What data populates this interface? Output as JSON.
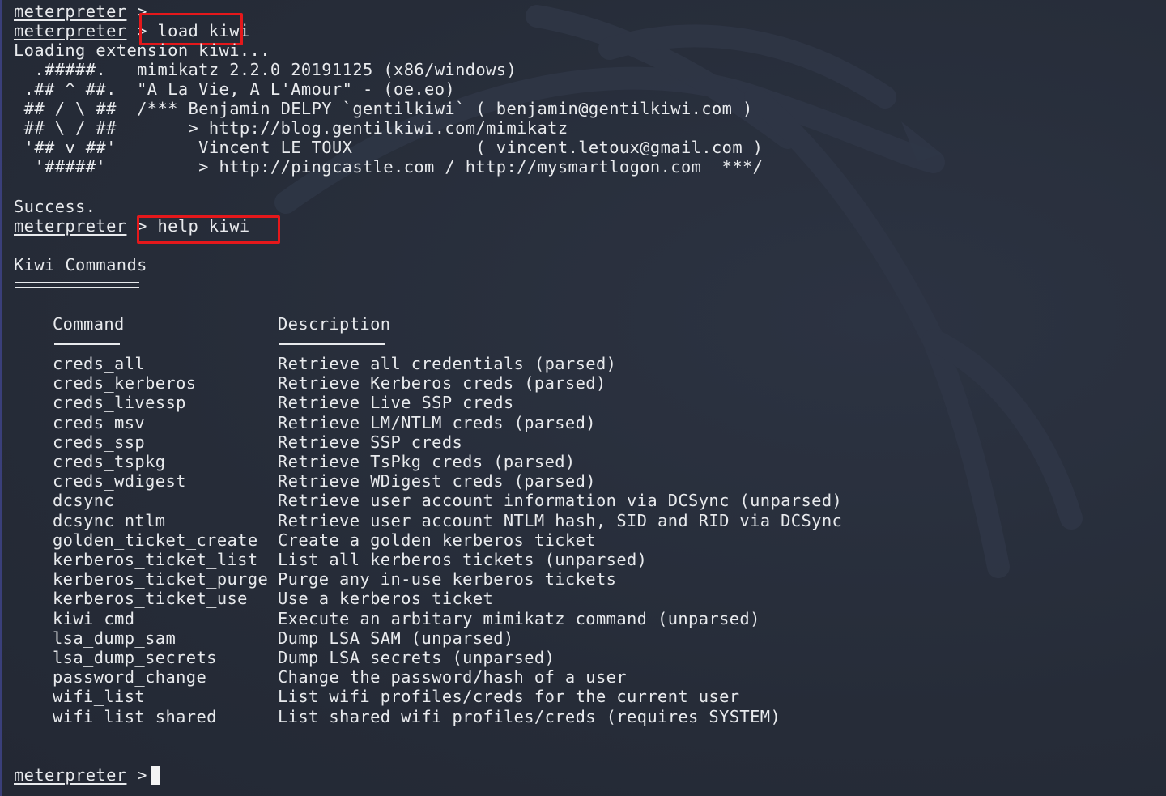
{
  "theme": {
    "background": "#262c38",
    "text": "#e8eaed",
    "highlight_box": "#e5181b"
  },
  "prompt": {
    "word": "meterpreter",
    "symbol": " >"
  },
  "session": {
    "line0_prompt": "meterpreter",
    "line0_rest": " >",
    "cmd1_prompt": "meterpreter",
    "cmd1_sep": " > ",
    "cmd1_text": "load kiwi",
    "loading": "Loading extension kiwi...",
    "banner": [
      "  .#####.   mimikatz 2.2.0 20191125 (x86/windows)",
      " .## ^ ##.  \"A La Vie, A L'Amour\" - (oe.eo)",
      " ## / \\ ##  /*** Benjamin DELPY `gentilkiwi` ( benjamin@gentilkiwi.com )",
      " ## \\ / ##       > http://blog.gentilkiwi.com/mimikatz",
      " '## v ##'        Vincent LE TOUX            ( vincent.letoux@gmail.com )",
      "  '#####'         > http://pingcastle.com / http://mysmartlogon.com  ***/"
    ],
    "success": "Success.",
    "cmd2_prompt": "meterpreter",
    "cmd2_sep": " > ",
    "cmd2_text": "help kiwi",
    "final_prompt": "meterpreter",
    "final_sep": " > "
  },
  "kiwi_commands": {
    "title": "Kiwi Commands",
    "col_command": "Command",
    "col_description": "Description",
    "rows": [
      {
        "command": "creds_all",
        "description": "Retrieve all credentials (parsed)"
      },
      {
        "command": "creds_kerberos",
        "description": "Retrieve Kerberos creds (parsed)"
      },
      {
        "command": "creds_livessp",
        "description": "Retrieve Live SSP creds"
      },
      {
        "command": "creds_msv",
        "description": "Retrieve LM/NTLM creds (parsed)"
      },
      {
        "command": "creds_ssp",
        "description": "Retrieve SSP creds"
      },
      {
        "command": "creds_tspkg",
        "description": "Retrieve TsPkg creds (parsed)"
      },
      {
        "command": "creds_wdigest",
        "description": "Retrieve WDigest creds (parsed)"
      },
      {
        "command": "dcsync",
        "description": "Retrieve user account information via DCSync (unparsed)"
      },
      {
        "command": "dcsync_ntlm",
        "description": "Retrieve user account NTLM hash, SID and RID via DCSync"
      },
      {
        "command": "golden_ticket_create",
        "description": "Create a golden kerberos ticket"
      },
      {
        "command": "kerberos_ticket_list",
        "description": "List all kerberos tickets (unparsed)"
      },
      {
        "command": "kerberos_ticket_purge",
        "description": "Purge any in-use kerberos tickets"
      },
      {
        "command": "kerberos_ticket_use",
        "description": "Use a kerberos ticket"
      },
      {
        "command": "kiwi_cmd",
        "description": "Execute an arbitary mimikatz command (unparsed)"
      },
      {
        "command": "lsa_dump_sam",
        "description": "Dump LSA SAM (unparsed)"
      },
      {
        "command": "lsa_dump_secrets",
        "description": "Dump LSA secrets (unparsed)"
      },
      {
        "command": "password_change",
        "description": "Change the password/hash of a user"
      },
      {
        "command": "wifi_list",
        "description": "List wifi profiles/creds for the current user"
      },
      {
        "command": "wifi_list_shared",
        "description": "List shared wifi profiles/creds (requires SYSTEM)"
      }
    ]
  }
}
